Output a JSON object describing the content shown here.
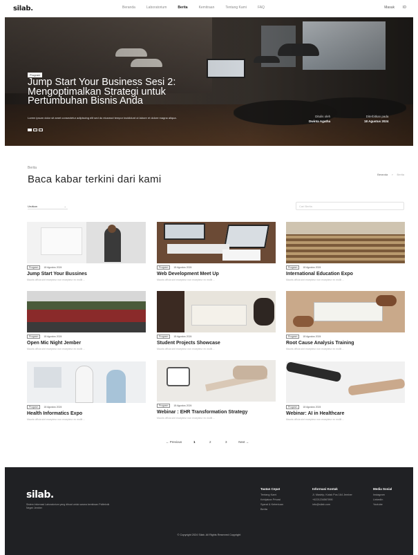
{
  "nav": {
    "logo": "silab.",
    "links": [
      "Beranda",
      "Laboratorium",
      "Berita",
      "Kemitraan",
      "Tentang Kami",
      "FAQ"
    ],
    "active_link": "Berita",
    "right": [
      "Masuk",
      "ID"
    ]
  },
  "hero": {
    "tag": "Program",
    "title": "Jump Start Your Business Sesi 2: Mengoptimalkan Strategi untuk Pertumbuhan Bisnis Anda",
    "description": "Lorem ipsum dolor sit amet consectetur adipiscing elit sed do eiusmod tempor incididunt ut labore et dolore magna aliqua.",
    "author_label": "Ditulis oleh",
    "author": "Dwinta Agatha",
    "date_label": "Diterbitkan pada",
    "date": "18 Agustus 2024"
  },
  "news": {
    "label": "Berita",
    "title": "Baca kabar terkini dari kami",
    "breadcrumb": [
      "Beranda",
      "Berita"
    ],
    "filter": "Urutkan",
    "search_placeholder": "Cari Berita",
    "cards": [
      {
        "tag": "Program",
        "date": "18 Agustus 2024",
        "title": "Jump Start Your Bussines",
        "excerpt": "Mauris officia sint excepteur non excepteur ex mollit ...",
        "img": "lecture"
      },
      {
        "tag": "Program",
        "date": "18 Agustus 2024",
        "title": "Web Development Meet Up",
        "excerpt": "Mauris officia sint excepteur non excepteur ex mollit ...",
        "img": "laptop"
      },
      {
        "tag": "Program",
        "date": "18 Agustus 2024",
        "title": "International Education Expo",
        "excerpt": "Mauris officia sint excepteur non excepteur ex mollit ...",
        "img": "hall"
      },
      {
        "tag": "Program",
        "date": "18 Agustus 2024",
        "title": "Open Mic Night Jember",
        "excerpt": "Mauris officia sint excepteur non excepteur ex mollit ...",
        "img": "audience"
      },
      {
        "tag": "Program",
        "date": "18 Agustus 2024",
        "title": "Student Projects Showcase",
        "excerpt": "Mauris officia sint excepteur non excepteur ex mollit ...",
        "img": "students"
      },
      {
        "tag": "Program",
        "date": "18 Agustus 2024",
        "title": "Root Cause Analysis Training",
        "excerpt": "Mauris officia sint excepteur non excepteur ex mollit ...",
        "img": "hands"
      },
      {
        "tag": "Program",
        "date": "18 Agustus 2024",
        "title": "Health Informatics Expo",
        "excerpt": "Mauris officia sint excepteur non excepteur ex mollit ...",
        "img": "doctor"
      },
      {
        "tag": "Program",
        "date": "18 Agustus 2024",
        "title": "Webinar : EHR Transformation Strategy",
        "excerpt": "Mauris officia sint excepteur non excepteur ex mollit ...",
        "img": "device"
      },
      {
        "tag": "Program",
        "date": "18 Agustus 2024",
        "title": "Webinar: AI in Healthcare",
        "excerpt": "Mauris officia sint excepteur non excepteur ex mollit ...",
        "img": "robot"
      }
    ]
  },
  "pagination": {
    "prev": "← Previous",
    "pages": [
      "1",
      "2",
      "3"
    ],
    "active_page": "1",
    "next": "Next →"
  },
  "footer": {
    "logo": "silab.",
    "tagline": "Sistem Informasi Laboratorium yang dibuat untuk sarana kemitraan Politeknik Negeri Jember",
    "cols": [
      {
        "title": "Tautan Cepat",
        "items": [
          "Tentang Kami",
          "Kebijakan Privasi",
          "Syarat & Ketentuan",
          "Berita"
        ]
      },
      {
        "title": "Informasi Kontak",
        "items": [
          "Jl. Mastrip, Kotak Pos 164 Jember",
          "+6221234567890",
          "info@silab.com"
        ]
      },
      {
        "title": "Media Sosial",
        "items": [
          "Instagram",
          "LinkedIn",
          "Youtube"
        ]
      }
    ],
    "copyright": "© Copyright 2024 Silab. All Rights Reserved Copyright"
  }
}
